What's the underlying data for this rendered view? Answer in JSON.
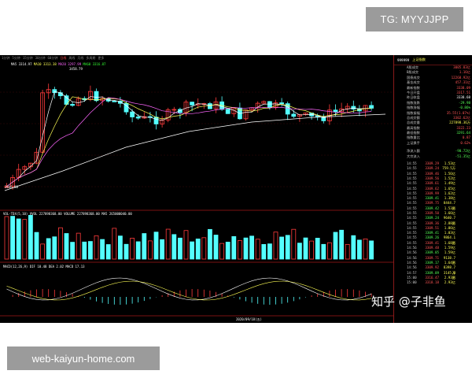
{
  "overlay": {
    "tg_badge": "TG: MYYJJPP",
    "watermark": "web-kaiyun-home.com",
    "zhihu": "知乎 @子非鱼"
  },
  "toolbar": {
    "items": [
      "1分钟",
      "5分钟",
      "15分钟",
      "30分钟",
      "60分钟",
      "日线",
      "周线",
      "月线",
      "多周期",
      "更多"
    ],
    "active_index": 5
  },
  "main_chart": {
    "ma_legend": [
      "MA5 3314.97",
      "MA10 3313.38",
      "MA20 3297.99",
      "MA60 3316.87"
    ],
    "high_label": "3458.79",
    "low_label": "2646.80"
  },
  "volume_panel": {
    "legend": "VOL-TDX(5,10)  VVOL 227898368.00  VOLUME 227898368.00  MA5 265000040.00"
  },
  "macd_panel": {
    "legend": "MACD(12,26,9) DIF 10.48 DEA 2.02 MACD 17.13"
  },
  "bottom_bar": {
    "date_label": "2020/09/18(五)"
  },
  "side_panel": {
    "code": "999999",
    "name": "上证指数",
    "stats": [
      {
        "k": "A股成交",
        "v": "3005.83亿",
        "c": ""
      },
      {
        "k": "B股成交",
        "v": "1.16亿",
        "c": ""
      },
      {
        "k": "国债成交",
        "v": "12268.92亿",
        "c": ""
      },
      {
        "k": "基金成交",
        "v": "457.31亿",
        "c": ""
      },
      {
        "k": "最新指数",
        "v": "3338.09",
        "c": ""
      },
      {
        "k": "今日开盘",
        "v": "3317.51",
        "c": ""
      },
      {
        "k": "昨日收盘",
        "v": "3338.68",
        "c": "w"
      },
      {
        "k": "指数涨跌",
        "v": "-29.98",
        "c": "g"
      },
      {
        "k": "指数涨幅",
        "v": "-0.86%",
        "c": "g"
      },
      {
        "k": "指数振幅",
        "v": "35.55(1.07%)",
        "c": ""
      },
      {
        "k": "总成交额",
        "v": "3302.62亿",
        "c": ""
      },
      {
        "k": "总成交量",
        "v": "227898.36万",
        "c": "y"
      },
      {
        "k": "最高指数",
        "v": "3322.23",
        "c": ""
      },
      {
        "k": "最低指数",
        "v": "3291.64",
        "c": "g"
      },
      {
        "k": "指数量比",
        "v": "0.87",
        "c": ""
      },
      {
        "k": "上证换手",
        "v": "0.62%",
        "c": ""
      }
    ],
    "flows": [
      {
        "k": "净流入额",
        "v": "-90.72亿",
        "c": "g"
      },
      {
        "k": "大宗流入",
        "v": "-51.35亿",
        "c": "g"
      }
    ],
    "ticks": [
      {
        "t": "14:55",
        "p": "3309.29",
        "c": "",
        "vol": "1.53亿"
      },
      {
        "t": "14:55",
        "p": "3309.24",
        "c": "",
        "vol": "759.5万"
      },
      {
        "t": "14:55",
        "p": "3309.46",
        "c": "",
        "vol": "1.56亿"
      },
      {
        "t": "14:55",
        "p": "3309.56",
        "c": "",
        "vol": "1.52亿"
      },
      {
        "t": "14:55",
        "p": "3309.61",
        "c": "",
        "vol": "1.49亿"
      },
      {
        "t": "14:55",
        "p": "3309.62",
        "c": "",
        "vol": "1.65亿"
      },
      {
        "t": "14:55",
        "p": "3309.99",
        "c": "",
        "vol": "1.62亿"
      },
      {
        "t": "14:55",
        "p": "3309.41",
        "c": "g",
        "vol": "1.38亿"
      },
      {
        "t": "14:55",
        "p": "3309.75",
        "c": "",
        "vol": "8444.7万"
      },
      {
        "t": "14:55",
        "p": "3309.42",
        "c": "g",
        "vol": "1.53亿"
      },
      {
        "t": "14:55",
        "p": "3309.50",
        "c": "",
        "vol": "1.66亿"
      },
      {
        "t": "14:55",
        "p": "3309.24",
        "c": "g",
        "vol": "9640.7万"
      },
      {
        "t": "14:55",
        "p": "3309.36",
        "c": "",
        "vol": "2.88亿"
      },
      {
        "t": "14:55",
        "p": "3309.51",
        "c": "",
        "vol": "1.86亿"
      },
      {
        "t": "14:55",
        "p": "3309.41",
        "c": "g",
        "vol": "1.03亿"
      },
      {
        "t": "14:55",
        "p": "3309.26",
        "c": "g",
        "vol": "9864.1万"
      },
      {
        "t": "14:55",
        "p": "3309.41",
        "c": "",
        "vol": "1.68亿"
      },
      {
        "t": "14:56",
        "p": "3309.48",
        "c": "",
        "vol": "1.59亿"
      },
      {
        "t": "14:56",
        "p": "3309.05",
        "c": "g",
        "vol": "1.59亿"
      },
      {
        "t": "14:56",
        "p": "3309.71",
        "c": "",
        "vol": "9138.7万"
      },
      {
        "t": "14:56",
        "p": "3309.17",
        "c": "g",
        "vol": "1.64亿"
      },
      {
        "t": "14:56",
        "p": "3309.92",
        "c": "",
        "vol": "8398.7万"
      },
      {
        "t": "14:57",
        "p": "3309.09",
        "c": "g",
        "vol": "3145.8万"
      },
      {
        "t": "15:00",
        "p": "3316.47",
        "c": "",
        "vol": "2.93亿"
      },
      {
        "t": "15:00",
        "p": "3318.18",
        "c": "",
        "vol": "2.93亿"
      }
    ]
  },
  "colors": {
    "up": "#ff3b3b",
    "down": "#54ffff",
    "ma_white": "#ffffff",
    "ma_yellow": "#ffff55",
    "ma_pink": "#ff66ff",
    "ma_green": "#33ff33"
  }
}
